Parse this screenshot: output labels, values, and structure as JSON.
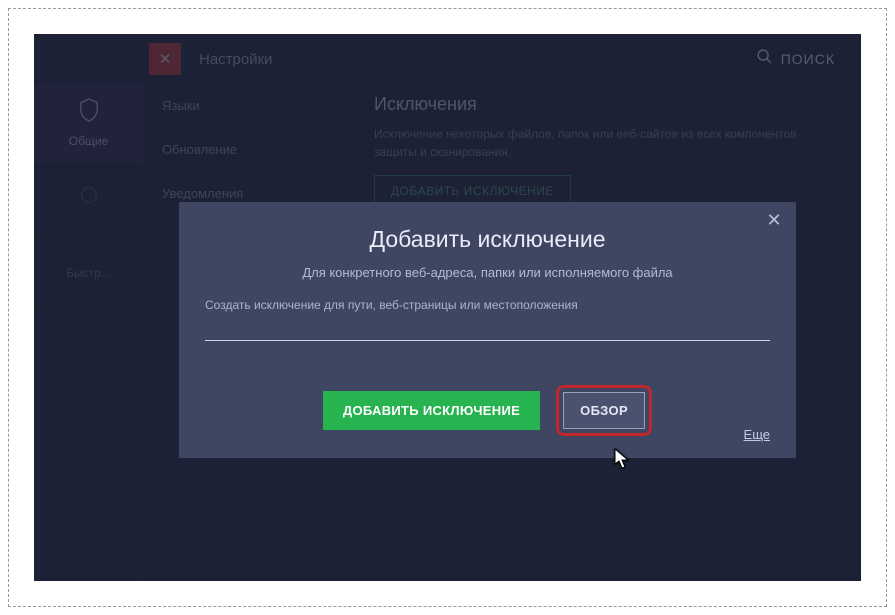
{
  "header": {
    "title": "Настройки",
    "search_label": "ПОИСК"
  },
  "sidebar": {
    "items": [
      {
        "label": "Общие"
      },
      {
        "label": ""
      },
      {
        "label": "Быстр..."
      }
    ]
  },
  "secondary_nav": {
    "items": [
      {
        "label": "Языки"
      },
      {
        "label": "Обновление"
      },
      {
        "label": "Уведомления"
      }
    ]
  },
  "content": {
    "heading": "Исключения",
    "description": "Исключение некоторых файлов, папок или веб-сайтов из всех компонентов защиты и сканирования.",
    "add_btn": "ДОБАВИТЬ ИСКЛЮЧЕНИЕ"
  },
  "modal": {
    "title": "Добавить исключение",
    "subtitle": "Для конкретного веб-адреса, папки или исполняемого файла",
    "field_label": "Создать исключение для пути, веб-страницы или местоположения",
    "add_btn": "ДОБАВИТЬ ИСКЛЮЧЕНИЕ",
    "browse_btn": "ОБЗОР",
    "more": "Еще"
  }
}
